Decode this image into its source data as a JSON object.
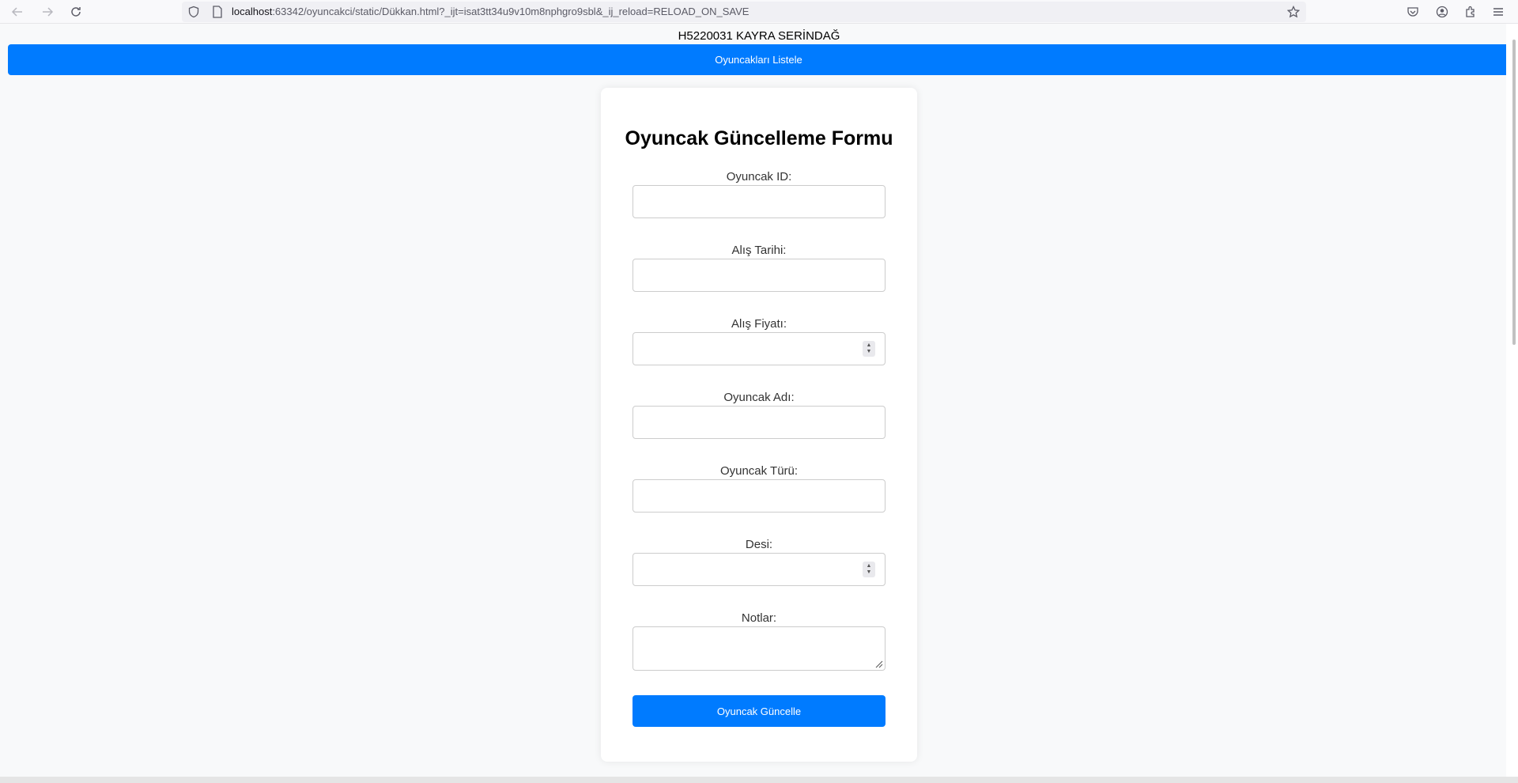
{
  "browser": {
    "url_host": "localhost",
    "url_rest": ":63342/oyuncakci/static/Dükkan.html?_ijt=isat3tt34u9v10m8nphgro9sbl&_ij_reload=RELOAD_ON_SAVE"
  },
  "header": {
    "title": "H5220031 KAYRA SERİNDAĞ",
    "list_button_label": "Oyuncakları Listele"
  },
  "form": {
    "title": "Oyuncak Güncelleme Formu",
    "fields": [
      {
        "label": "Oyuncak ID:",
        "value": ""
      },
      {
        "label": "Alış Tarihi:",
        "value": ""
      },
      {
        "label": "Alış Fiyatı:",
        "value": ""
      },
      {
        "label": "Oyuncak Adı:",
        "value": ""
      },
      {
        "label": "Oyuncak Türü:",
        "value": ""
      },
      {
        "label": "Desi:",
        "value": ""
      },
      {
        "label": "Notlar:",
        "value": ""
      }
    ],
    "submit_label": "Oyuncak Güncelle"
  },
  "colors": {
    "accent": "#007bff",
    "page_bg": "#f8f9fa"
  }
}
